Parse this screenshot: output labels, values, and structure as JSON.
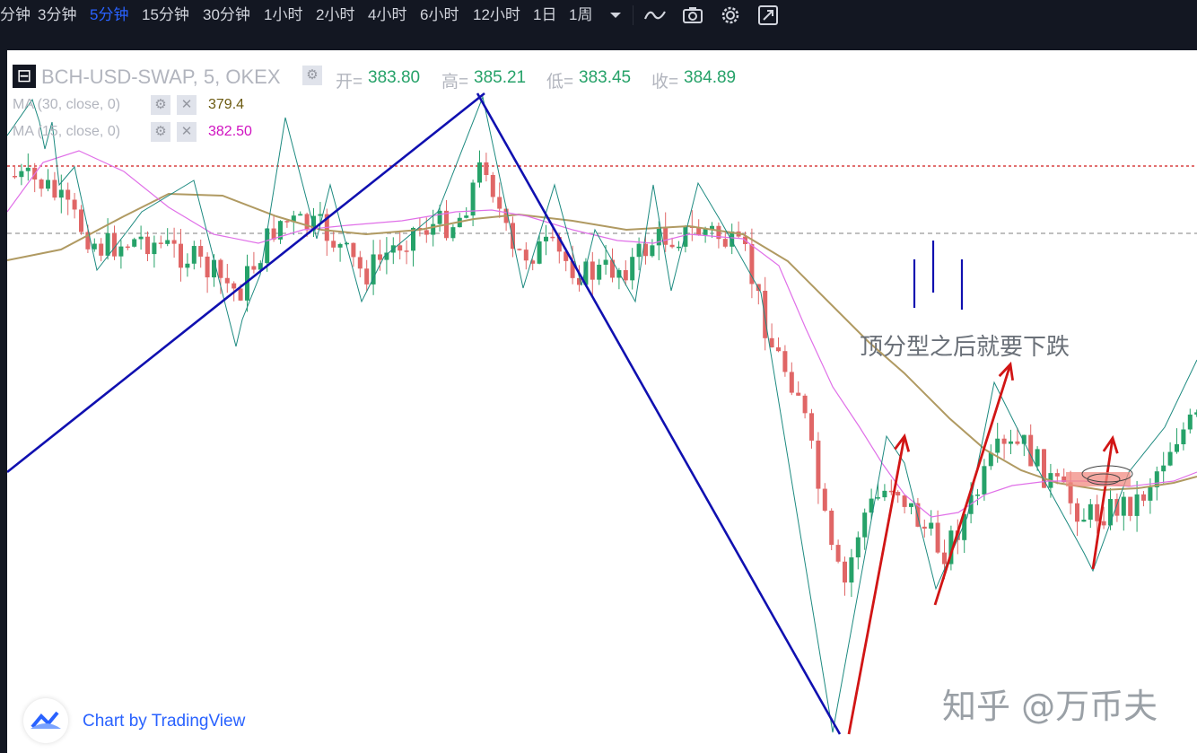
{
  "toolbar": {
    "timeframes": [
      {
        "label": "分钟",
        "active": false
      },
      {
        "label": "3分钟",
        "active": false
      },
      {
        "label": "5分钟",
        "active": true
      },
      {
        "label": "15分钟",
        "active": false
      },
      {
        "label": "30分钟",
        "active": false
      },
      {
        "label": "1小时",
        "active": false
      },
      {
        "label": "2小时",
        "active": false
      },
      {
        "label": "4小时",
        "active": false
      },
      {
        "label": "6小时",
        "active": false
      },
      {
        "label": "12小时",
        "active": false
      },
      {
        "label": "1日",
        "active": false
      },
      {
        "label": "1周",
        "active": false
      }
    ],
    "icons": [
      "dropdown-arrow-icon",
      "line-chart-icon",
      "camera-icon",
      "gear-icon",
      "fullscreen-icon"
    ]
  },
  "legend": {
    "symbol": "BCH-USD-SWAP, 5, OKEX",
    "open_label": "开=",
    "open": "383.80",
    "high_label": "高=",
    "high": "385.21",
    "low_label": "低=",
    "low": "383.45",
    "close_label": "收=",
    "close": "384.89",
    "ma1": {
      "label": "MA (30, close, 0)",
      "value": "379.4",
      "color": "#6b5a10"
    },
    "ma2": {
      "label": "MA (15, close, 0)",
      "value": "382.50",
      "color": "#d012c0"
    }
  },
  "annotations": {
    "text": "顶分型之后就要下跌",
    "watermark": "知乎 @万币夫"
  },
  "branding": {
    "text": "Chart by TradingView"
  },
  "colors": {
    "up": "#26a269",
    "down": "#e06666",
    "trendline": "#1010b0",
    "arrow": "#d11515",
    "zigzag": "#1d8a80",
    "ma30": "#b09a62",
    "ma15": "#e070e8",
    "resistance": "#d94040",
    "level": "#999999"
  }
}
